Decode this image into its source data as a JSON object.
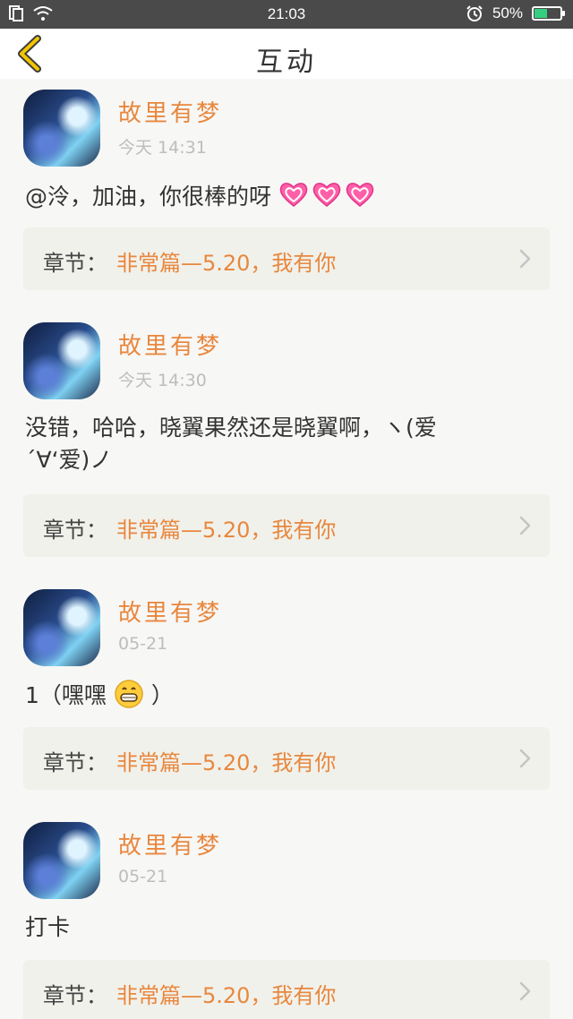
{
  "status_bar": {
    "time": "21:03",
    "battery": "50%",
    "battery_level": 0.5,
    "battery_color": "#35d07f"
  },
  "header": {
    "title": "互动"
  },
  "colors": {
    "accent": "#e8873e",
    "text": "#333333",
    "muted": "#bdbdbd",
    "card_bg": "#f1f1eb"
  },
  "feed": [
    {
      "username": "故里有梦",
      "time": "今天 14:31",
      "text": "@泠，加油，你很棒的呀",
      "emoji": "heart-emoji x3",
      "chapter_label": "章节：",
      "chapter_title": "非常篇—5.20，我有你"
    },
    {
      "username": "故里有梦",
      "time": "今天 14:30",
      "text": "没错，哈哈，晓翼果然还是晓翼啊，ヽ(爱´∀‘爱)ノ",
      "chapter_label": "章节：",
      "chapter_title": "非常篇—5.20，我有你"
    },
    {
      "username": "故里有梦",
      "time": "05-21",
      "text_before": "1（嘿嘿",
      "text_after": "）",
      "emoji": "grin-emoji",
      "chapter_label": "章节：",
      "chapter_title": "非常篇—5.20，我有你"
    },
    {
      "username": "故里有梦",
      "time": "05-21",
      "text": "打卡",
      "chapter_label": "章节：",
      "chapter_title": "非常篇—5.20，我有你"
    }
  ]
}
